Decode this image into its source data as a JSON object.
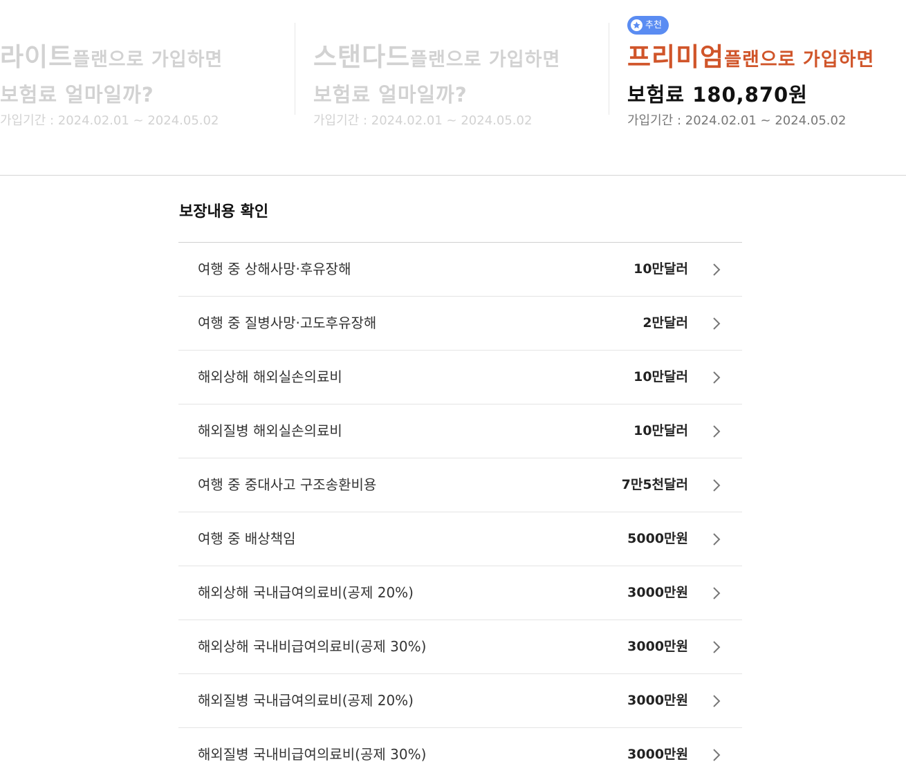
{
  "plans": [
    {
      "name": "라이트",
      "suffix": "플랜으로 가입하면",
      "price_line": "보험료 얼마일까?",
      "period": "가입기간 : 2024.02.01 ~ 2024.05.02",
      "active": false
    },
    {
      "name": "스탠다드",
      "suffix": "플랜으로 가입하면",
      "price_line": "보험료 얼마일까?",
      "period": "가입기간 : 2024.02.01 ~ 2024.05.02",
      "active": false
    },
    {
      "badge": "추천",
      "badge_icon": "star-icon",
      "name": "프리미엄",
      "suffix": "플랜으로 가입하면",
      "price_line": "보험료 180,870원",
      "period": "가입기간 : 2024.02.01 ~ 2024.05.02",
      "active": true
    }
  ],
  "colors": {
    "accent": "#d0552a",
    "badge": "#5a8cf2",
    "dim_text": "#d2d2d2"
  },
  "coverage": {
    "title": "보장내용 확인",
    "items": [
      {
        "name": "여행 중 상해사망·후유장해",
        "amount": "10만달러"
      },
      {
        "name": "여행 중 질병사망·고도후유장해",
        "amount": "2만달러"
      },
      {
        "name": "해외상해 해외실손의료비",
        "amount": "10만달러"
      },
      {
        "name": "해외질병 해외실손의료비",
        "amount": "10만달러"
      },
      {
        "name": "여행 중 중대사고 구조송환비용",
        "amount": "7만5천달러"
      },
      {
        "name": "여행 중 배상책임",
        "amount": "5000만원"
      },
      {
        "name": "해외상해 국내급여의료비(공제 20%)",
        "amount": "3000만원"
      },
      {
        "name": "해외상해 국내비급여의료비(공제 30%)",
        "amount": "3000만원"
      },
      {
        "name": "해외질병 국내급여의료비(공제 20%)",
        "amount": "3000만원"
      },
      {
        "name": "해외질병 국내비급여의료비(공제 30%)",
        "amount": "3000만원"
      }
    ]
  }
}
